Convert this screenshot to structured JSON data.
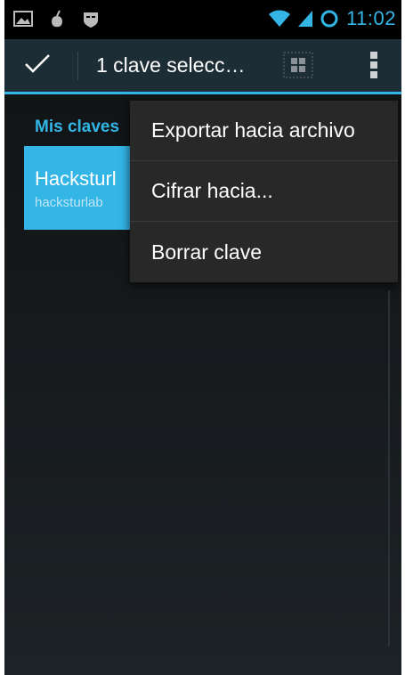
{
  "status_bar": {
    "time": "11:02",
    "left_icons": [
      "gallery-icon",
      "app-icon",
      "mask-icon"
    ],
    "right_icons": [
      "wifi-icon",
      "signal-icon",
      "sync-icon"
    ]
  },
  "action_bar": {
    "title": "1 clave selecc…",
    "icons": [
      "check-icon",
      "select-all-icon",
      "overflow-menu-icon"
    ]
  },
  "list": {
    "section_header": "Mis claves",
    "items": [
      {
        "name": "Hacksturl",
        "email": "hacksturlab"
      }
    ]
  },
  "menu": {
    "items": [
      {
        "label": "Exportar hacia archivo"
      },
      {
        "label": "Cifrar hacia..."
      },
      {
        "label": "Borrar clave"
      }
    ]
  },
  "colors": {
    "accent": "#33b5e5",
    "action_bar": "#1d2d36",
    "menu_background": "#282828"
  }
}
